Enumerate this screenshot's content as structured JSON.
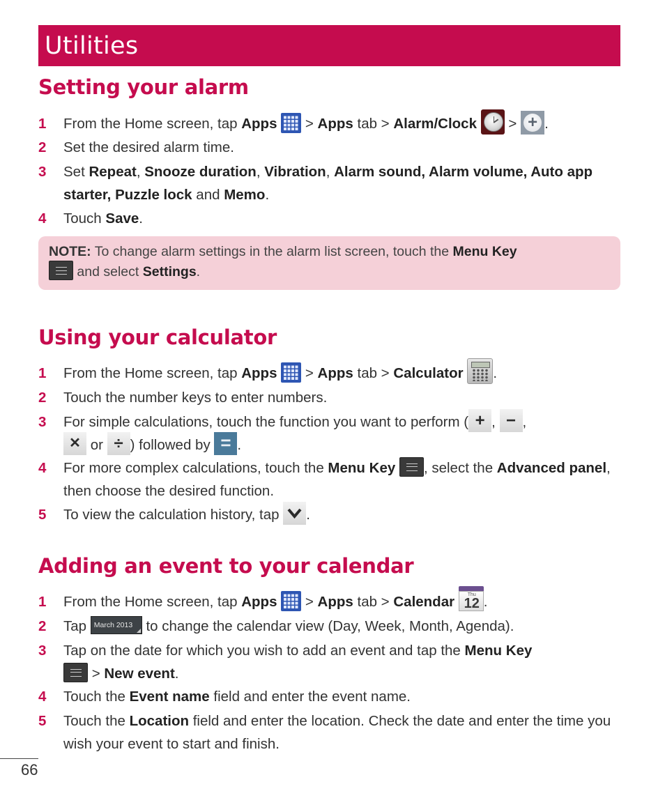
{
  "banner": {
    "title": "Utilities"
  },
  "brand_color": "#c50c4e",
  "note_bg_color": "#f5d0d8",
  "sections": [
    {
      "title": "Setting your alarm",
      "steps": [
        {
          "num": "1",
          "parts": [
            "From the Home screen, tap ",
            "Apps",
            " > ",
            "Apps",
            " tab > ",
            "Alarm/Clock",
            " > ",
            "."
          ]
        },
        {
          "num": "2",
          "text": "Set the desired alarm time."
        },
        {
          "num": "3",
          "parts": [
            "Set ",
            "Repeat",
            ", ",
            "Snooze duration",
            ", ",
            "Vibration",
            ", ",
            "Alarm sound, Alarm volume, Auto app starter, Puzzle lock",
            " and ",
            "Memo",
            "."
          ]
        },
        {
          "num": "4",
          "parts": [
            "Touch ",
            "Save",
            "."
          ]
        }
      ],
      "note": {
        "label": "NOTE:",
        "parts": [
          " To change alarm settings in the alarm list screen, touch the ",
          "Menu Key",
          " and select ",
          "Settings",
          "."
        ]
      }
    },
    {
      "title": "Using your calculator",
      "steps": [
        {
          "num": "1",
          "parts": [
            "From the Home screen, tap ",
            "Apps",
            " > ",
            "Apps",
            " tab > ",
            "Calculator",
            "."
          ]
        },
        {
          "num": "2",
          "text": "Touch the number keys to enter numbers."
        },
        {
          "num": "3",
          "parts": [
            "For simple calculations, touch the function you want to perform (",
            ", ",
            ",",
            " or ",
            ") followed by ",
            "."
          ]
        },
        {
          "num": "4",
          "parts": [
            "For more complex calculations, touch the ",
            "Menu Key",
            ", select the ",
            "Advanced panel",
            ", then choose the desired function."
          ]
        },
        {
          "num": "5",
          "parts": [
            "To view the calculation history, tap ",
            "."
          ]
        }
      ],
      "operators": {
        "plus": "+",
        "minus": "−",
        "times": "✕",
        "divide": "÷",
        "equals": "="
      }
    },
    {
      "title": "Adding an event to your calendar",
      "steps": [
        {
          "num": "1",
          "parts": [
            "From the Home screen, tap ",
            "Apps",
            " > ",
            "Apps",
            " tab > ",
            "Calendar",
            "."
          ]
        },
        {
          "num": "2",
          "parts": [
            "Tap ",
            " to change the calendar view (Day, Week, Month, Agenda)."
          ]
        },
        {
          "num": "3",
          "parts": [
            "Tap on the date for which you wish to add an event and tap the ",
            "Menu Key",
            " > ",
            "New event",
            "."
          ]
        },
        {
          "num": "4",
          "parts": [
            "Touch the ",
            "Event name",
            " field and enter the event name."
          ]
        },
        {
          "num": "5",
          "parts": [
            "Touch the ",
            "Location",
            " field and enter the location. Check the date and enter the time you wish your event to start and finish."
          ]
        }
      ],
      "calendar_icon": {
        "day": "Thu",
        "date": "12"
      },
      "month_button": "March 2013"
    }
  ],
  "icons": {
    "apps": "apps-grid-icon",
    "alarm": "alarm-clock-icon",
    "add": "plus-circle-icon",
    "menu": "menu-key-icon",
    "calculator": "calculator-icon",
    "calendar": "calendar-icon",
    "history": "chevron-down-icon"
  },
  "footer": {
    "page_number": "66"
  }
}
